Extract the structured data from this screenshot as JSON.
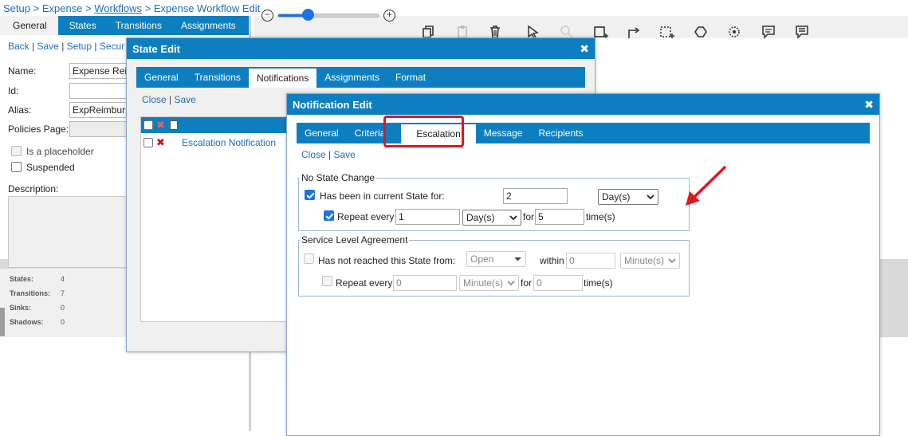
{
  "breadcrumb": {
    "items": [
      "Setup",
      "Expense",
      "Workflows",
      "Expense Workflow Edit"
    ],
    "separator": ">"
  },
  "main_tabs": [
    {
      "label": "General",
      "active": true
    },
    {
      "label": "States",
      "active": false
    },
    {
      "label": "Transitions",
      "active": false
    },
    {
      "label": "Assignments",
      "active": false
    }
  ],
  "main_links": {
    "back": "Back",
    "save": "Save",
    "setup": "Setup",
    "security": "Secur",
    "sep": "|"
  },
  "form": {
    "name_label": "Name:",
    "name_value": "Expense Rei",
    "id_label": "Id:",
    "id_value": "",
    "alias_label": "Alias:",
    "alias_value": "ExpReimburs",
    "policies_label": "Policies Page:",
    "policies_value": "",
    "placeholder_label": "Is a placeholder",
    "suspended_label": "Suspended",
    "description_label": "Description:"
  },
  "stats": [
    {
      "label": "States:",
      "value": "4"
    },
    {
      "label": "Transitions:",
      "value": "7"
    },
    {
      "label": "Sinks:",
      "value": "0"
    },
    {
      "label": "Shadows:",
      "value": "0"
    }
  ],
  "toolbar": {
    "zoom_level": 0.3,
    "icons": [
      "copy-icon",
      "paste-icon",
      "delete-icon",
      "select-pointer-icon",
      "zoom-icon",
      "add-state-icon",
      "add-transition-icon",
      "marquee-select-icon",
      "add-shape-icon",
      "add-polygon-icon",
      "comment-icon",
      "comment-filled-icon"
    ]
  },
  "state_edit": {
    "title": "State Edit",
    "close_glyph": "✖",
    "tabs": [
      {
        "label": "General",
        "active": false
      },
      {
        "label": "Transitions",
        "active": false
      },
      {
        "label": "Notifications",
        "active": true
      },
      {
        "label": "Assignments",
        "active": false
      },
      {
        "label": "Format",
        "active": false
      }
    ],
    "links": {
      "close": "Close",
      "save": "Save",
      "sep": "|"
    },
    "grid": {
      "rows": [
        {
          "label": "Escalation Notification"
        }
      ]
    }
  },
  "notification_edit": {
    "title": "Notification Edit",
    "close_glyph": "✖",
    "tabs": [
      {
        "label": "General",
        "active": false
      },
      {
        "label": "Criteria",
        "active": false
      },
      {
        "label": "Escalation",
        "active": true
      },
      {
        "label": "Message",
        "active": false
      },
      {
        "label": "Recipients",
        "active": false
      }
    ],
    "links": {
      "close": "Close",
      "save": "Save",
      "sep": "|"
    },
    "no_state_change": {
      "legend": "No State Change",
      "has_been_label": "Has been in current State for:",
      "has_been_checked": true,
      "has_been_value": "2",
      "has_been_unit": "Day(s)",
      "repeat_label": "Repeat every",
      "repeat_checked": true,
      "repeat_value": "1",
      "repeat_unit": "Day(s)",
      "for_label": "for",
      "for_value": "5",
      "times_label": "time(s)"
    },
    "sla": {
      "legend": "Service Level Agreement",
      "not_reached_label": "Has not reached this State from:",
      "not_reached_checked": false,
      "from_state": "Open",
      "within_label": "within",
      "within_value": "0",
      "within_unit": "Minute(s)",
      "repeat_label": "Repeat every",
      "repeat_checked": false,
      "repeat_value": "0",
      "repeat_unit": "Minute(s)",
      "for_label": "for",
      "for_value": "0",
      "times_label": "time(s)"
    }
  },
  "colors": {
    "accent": "#0d7fc1",
    "highlight": "#e0161f",
    "link": "#1f6fb5",
    "checkbox": "#1a73e8"
  }
}
